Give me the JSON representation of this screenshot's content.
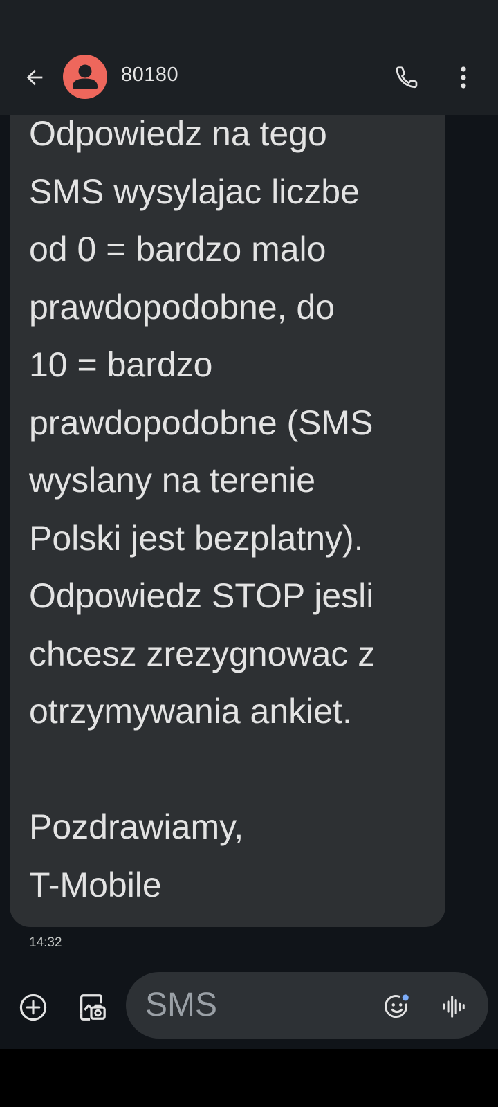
{
  "header": {
    "contact_name": "80180",
    "avatar_color": "#ee675c"
  },
  "message": {
    "text": "Odpowiedz na tego\nSMS wysylajac liczbe\nod 0 = bardzo malo\nprawdopodobne, do\n10 = bardzo\nprawdopodobne (SMS\nwyslany na terenie\nPolski jest bezplatny).\nOdpowiedz STOP jesli\nchcesz zrezygnowac z\notrzymywania ankiet.\n\nPozdrawiamy,\nT-Mobile",
    "timestamp": "14:32"
  },
  "composer": {
    "placeholder": "SMS",
    "badge_color": "#7cacf8"
  },
  "icons": {
    "back": "arrow-back-icon",
    "avatar": "person-icon",
    "call": "phone-icon",
    "more": "more-vert-icon",
    "add": "add-circle-icon",
    "gallery": "gallery-icon",
    "emoji": "emoji-icon",
    "voice": "voice-waveform-icon"
  }
}
